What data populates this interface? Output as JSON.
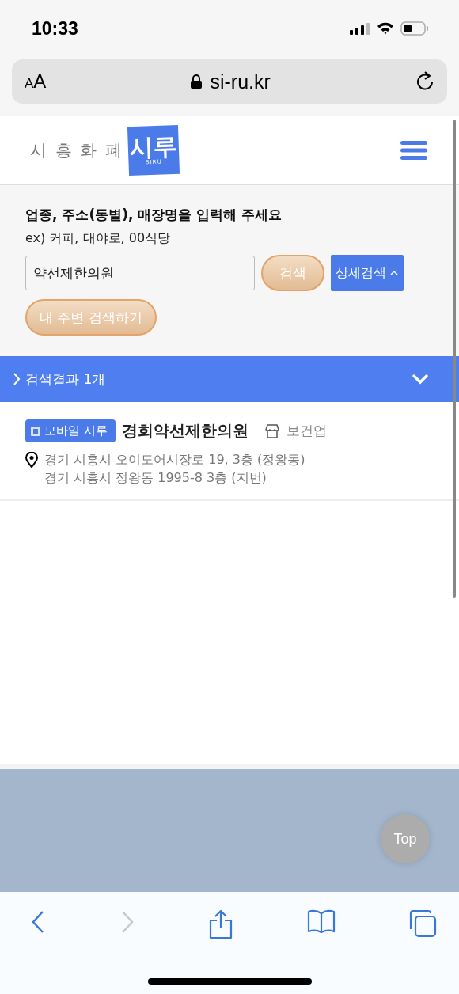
{
  "status_bar": {
    "time": "10:33"
  },
  "address_bar": {
    "text_size_button": "AA",
    "url": "si-ru.kr"
  },
  "header": {
    "site_name": "시 흥 화 폐",
    "logo_text": "시루",
    "logo_subtext": "SIRU"
  },
  "search": {
    "title": "업종, 주소(동별), 매장명을 입력해 주세요",
    "example": "ex) 커피, 대야로, 00식당",
    "value": "약선제한의원",
    "search_button": "검색",
    "detail_button": "상세검색",
    "detail_expanded": true,
    "nearby_button": "내 주변 검색하기"
  },
  "results_bar": {
    "label": "검색결과 1개",
    "expanded": false
  },
  "results": [
    {
      "badge": "모바일 시루",
      "name": "경희약선제한의원",
      "category": "보건업",
      "address_road": "경기 시흥시 오이도어시장로 19, 3층 (정왕동)",
      "address_lot": "경기 시흥시 정왕동 1995-8 3층 (지번)"
    }
  ],
  "top_button": "Top",
  "toolbar": {
    "back_disabled": false,
    "forward_disabled": true
  }
}
